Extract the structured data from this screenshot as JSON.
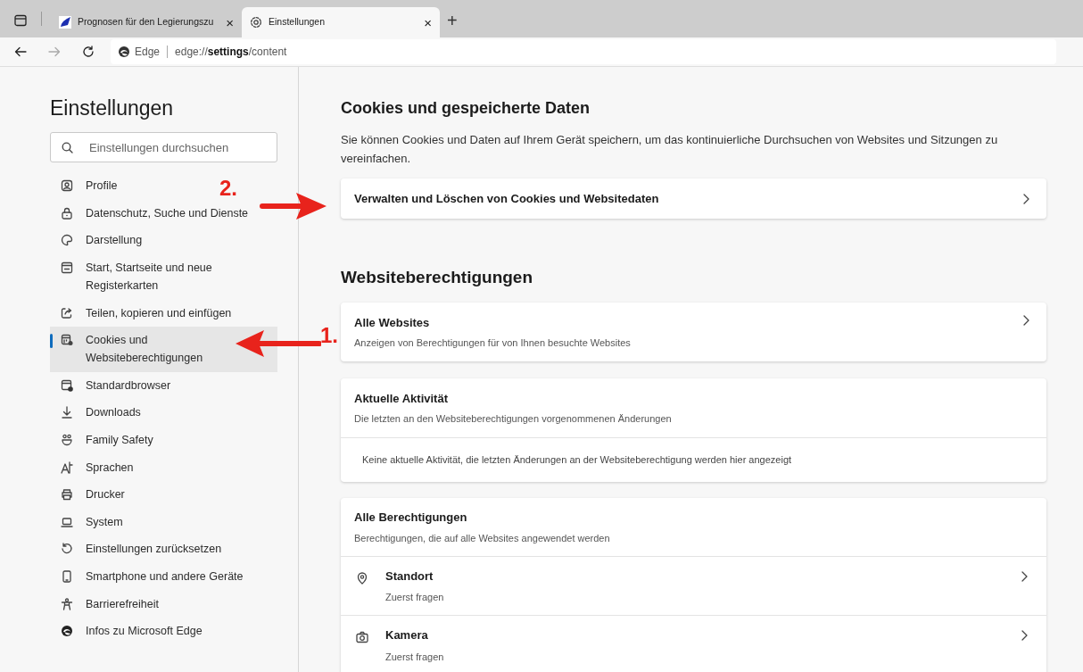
{
  "tabs": [
    {
      "title": "Prognosen für den Legierungszu",
      "selected": false,
      "close": "×"
    },
    {
      "title": "Einstellungen",
      "selected": true,
      "close": "×"
    }
  ],
  "new_tab": "+",
  "address_bar": {
    "site": "Edge",
    "url_prefix": "edge://",
    "url_host": "settings",
    "url_path": "/content"
  },
  "sidebar": {
    "title": "Einstellungen",
    "search": {
      "placeholder": "Einstellungen durchsuchen"
    },
    "items": [
      {
        "label": "Profile",
        "selected": false
      },
      {
        "label": "Datenschutz, Suche und Dienste",
        "selected": false
      },
      {
        "label": "Darstellung",
        "selected": false
      },
      {
        "label": "Start, Startseite und neue Registerkarten",
        "selected": false
      },
      {
        "label": "Teilen, kopieren und einfügen",
        "selected": false
      },
      {
        "label": "Cookies und Websiteberechtigungen",
        "selected": true
      },
      {
        "label": "Standardbrowser",
        "selected": false
      },
      {
        "label": "Downloads",
        "selected": false
      },
      {
        "label": "Family Safety",
        "selected": false
      },
      {
        "label": "Sprachen",
        "selected": false
      },
      {
        "label": "Drucker",
        "selected": false
      },
      {
        "label": "System",
        "selected": false
      },
      {
        "label": "Einstellungen zurücksetzen",
        "selected": false
      },
      {
        "label": "Smartphone und andere Geräte",
        "selected": false
      },
      {
        "label": "Barrierefreiheit",
        "selected": false
      },
      {
        "label": "Infos zu Microsoft Edge",
        "selected": false
      }
    ]
  },
  "cookies_section": {
    "title": "Cookies und gespeicherte Daten",
    "description": "Sie können Cookies und Daten auf Ihrem Gerät speichern, um das kontinuierliche Durchsuchen von Websites und Sitzungen zu vereinfachen.",
    "link_card": {
      "title": "Verwalten und Löschen von Cookies und Websitedaten"
    }
  },
  "permissions_section": {
    "title": "Websiteberechtigungen",
    "all_sites": {
      "title": "Alle Websites",
      "subtitle": "Anzeigen von Berechtigungen für von Ihnen besuchte Websites"
    },
    "recent_activity": {
      "title": "Aktuelle Aktivität",
      "subtitle": "Die letzten an den Websiteberechtigungen vorgenommenen Änderungen",
      "empty_text": "Keine aktuelle Aktivität, die letzten Änderungen an der Websiteberechtigung werden hier angezeigt"
    },
    "all_permissions": {
      "title": "Alle Berechtigungen",
      "subtitle": "Berechtigungen, die auf alle Websites angewendet werden",
      "rows": [
        {
          "title": "Standort",
          "value": "Zuerst fragen"
        },
        {
          "title": "Kamera",
          "value": "Zuerst fragen"
        }
      ]
    }
  },
  "annotations": [
    {
      "label": "1."
    },
    {
      "label": "2."
    }
  ]
}
